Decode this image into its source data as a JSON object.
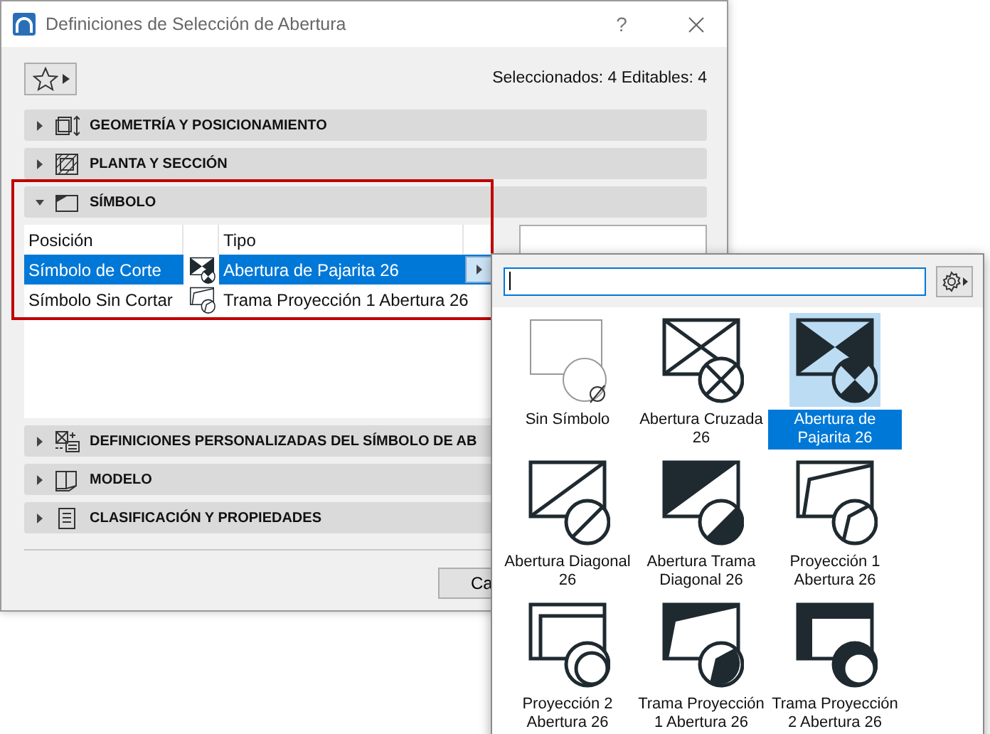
{
  "window": {
    "title": "Definiciones de Selección de Abertura",
    "help": "?"
  },
  "toolbar": {
    "selection_info": "Seleccionados: 4 Editables: 4"
  },
  "sections": [
    {
      "label": "GEOMETRÍA Y POSICIONAMIENTO",
      "kind": "geometry",
      "expanded": false
    },
    {
      "label": "PLANTA Y SECCIÓN",
      "kind": "plan",
      "expanded": false
    },
    {
      "label": "SÍMBOLO",
      "kind": "symbol",
      "expanded": true,
      "table": {
        "columns": [
          "Posición",
          "Tipo"
        ],
        "rows": [
          {
            "position": "Símbolo de Corte",
            "kind": "bowtie",
            "type": "Abertura de Pajarita 26",
            "selected": true
          },
          {
            "position": "Símbolo Sin Cortar",
            "kind": "proj1",
            "type": "Trama Proyección 1 Abertura 26",
            "selected": false
          }
        ]
      }
    },
    {
      "label": "DEFINICIONES PERSONALIZADAS DEL SÍMBOLO DE AB",
      "kind": "custom",
      "expanded": false
    },
    {
      "label": "MODELO",
      "kind": "model",
      "expanded": false
    },
    {
      "label": "CLASIFICACIÓN Y PROPIEDADES",
      "kind": "classification",
      "expanded": false
    }
  ],
  "footer": {
    "buttons": [
      "Ca"
    ]
  },
  "picker": {
    "items": [
      {
        "label": "Sin Símbolo",
        "kind": "none",
        "selected": false
      },
      {
        "label": "Abertura Cruzada 26",
        "kind": "crossed",
        "selected": false
      },
      {
        "label": "Abertura de Pajarita 26",
        "kind": "bowtie",
        "selected": true
      },
      {
        "label": "Abertura Diagonal 26",
        "kind": "diagonal",
        "selected": false
      },
      {
        "label": "Abertura Trama Diagonal 26",
        "kind": "diagonal-fill",
        "selected": false
      },
      {
        "label": "Proyección 1 Abertura 26",
        "kind": "proj1",
        "selected": false
      },
      {
        "label": "Proyección 2 Abertura 26",
        "kind": "proj2",
        "selected": false
      },
      {
        "label": "Trama Proyección 1 Abertura 26",
        "kind": "proj1-fill",
        "selected": false
      },
      {
        "label": "Trama Proyección 2 Abertura 26",
        "kind": "proj2-fill",
        "selected": false
      }
    ]
  }
}
